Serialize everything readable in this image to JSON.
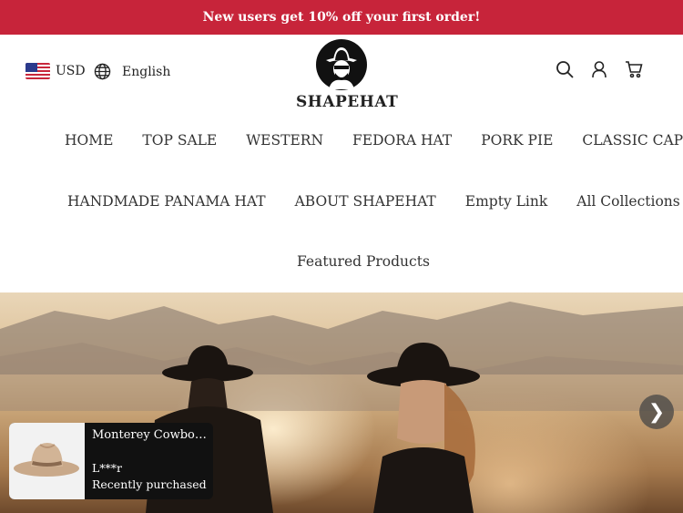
{
  "announcement": "New users get 10% off your first order!",
  "header": {
    "currency": "USD",
    "language": "English",
    "logo_text": "SHAPEHAT"
  },
  "nav": {
    "row1": [
      "HOME",
      "TOP SALE",
      "WESTERN",
      "FEDORA HAT",
      "PORK PIE",
      "CLASSIC CAP"
    ],
    "row2": [
      "HANDMADE PANAMA HAT",
      "ABOUT SHAPEHAT",
      "Empty Link",
      "All Collections"
    ],
    "row3": [
      "Featured Products"
    ]
  },
  "hero": {
    "next_arrow": "❯"
  },
  "popup": {
    "title": "Monterey Cowboy Hat",
    "buyer": "L***r",
    "note": "Recently purchased"
  },
  "colors": {
    "announcement_bg": "#c7243a"
  },
  "icons": [
    "flag-us-icon",
    "globe-icon",
    "search-icon",
    "account-icon",
    "cart-icon",
    "chevron-right-icon"
  ]
}
